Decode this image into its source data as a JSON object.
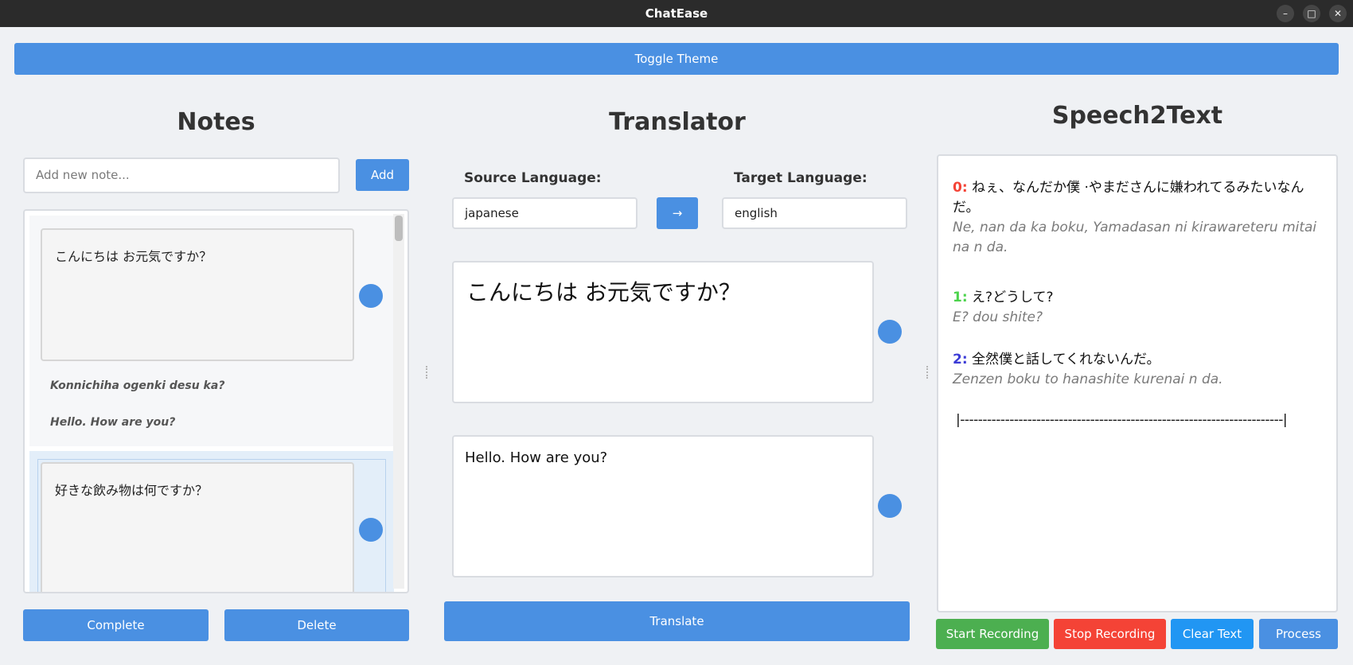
{
  "window": {
    "title": "ChatEase"
  },
  "toolbar": {
    "toggle_theme": "Toggle Theme"
  },
  "notes": {
    "heading": "Notes",
    "input_placeholder": "Add new note...",
    "add_label": "Add",
    "items": [
      {
        "text": "こんにちは お元気ですか？",
        "romaji": "Konnichiha ogenki desu ka?",
        "translation": "Hello. How are you?"
      },
      {
        "text": "好きな飲み物は何ですか？"
      }
    ],
    "complete_label": "Complete",
    "delete_label": "Delete"
  },
  "translator": {
    "heading": "Translator",
    "source_label": "Source Language:",
    "target_label": "Target Language:",
    "source_value": "japanese",
    "target_value": "english",
    "swap_label": "→",
    "source_text": "こんにちは お元気ですか？",
    "target_text": "Hello. How are you?",
    "translate_label": "Translate"
  },
  "speech2text": {
    "heading": "Speech2Text",
    "entries": [
      {
        "index": "0:",
        "color": "#f44336",
        "text": "ねぇ、なんだか僕 ·やまださんに嫌われてるみたいなんだ。",
        "romaji": "Ne, nan da ka boku, Yamadasan ni kirawareteru mitai na n da."
      },
      {
        "index": "1:",
        "color": "#4cd34c",
        "text": "え?どうして?",
        "romaji": "E? dou shite?"
      },
      {
        "index": "2:",
        "color": "#3b3bd6",
        "text": "全然僕と話してくれないんだ。",
        "romaji": "Zenzen boku to hanashite kurenai n da."
      }
    ],
    "separator": "|------------------------------------------------------------------------|",
    "buttons": {
      "start": "Start Recording",
      "stop": "Stop Recording",
      "clear": "Clear Text",
      "process": "Process"
    }
  },
  "colors": {
    "accent": "#4a90e2",
    "start": "#4caf50",
    "stop": "#f44336",
    "clear": "#2196f3",
    "process": "#4a90e2"
  }
}
